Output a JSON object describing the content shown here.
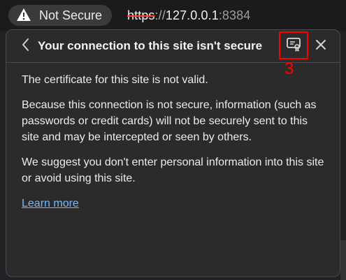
{
  "address_bar": {
    "security_label": "Not Secure",
    "url_scheme": "https",
    "url_separator": "://",
    "url_host": "127.0.0.1",
    "url_port": ":8384",
    "warning_icon": "warning-icon"
  },
  "popup": {
    "title": "Your connection to this site isn't secure",
    "back_icon": "chevron-left-icon",
    "certificate_icon": "certificate-icon",
    "close_icon": "close-icon",
    "annotation_number": "3",
    "paragraphs": [
      "The certificate for this site is not valid.",
      "Because this connection is not secure, information (such as passwords or credit cards) will not be securely sent to this site and may be intercepted or seen by others.",
      "We suggest you don't enter personal information into this site or avoid using this site."
    ],
    "learn_more_label": "Learn more"
  },
  "colors": {
    "background": "#2b2b2b",
    "text": "#ececec",
    "link": "#79b8ff",
    "annotation": "#ff0000",
    "strike": "#ff3b30"
  }
}
